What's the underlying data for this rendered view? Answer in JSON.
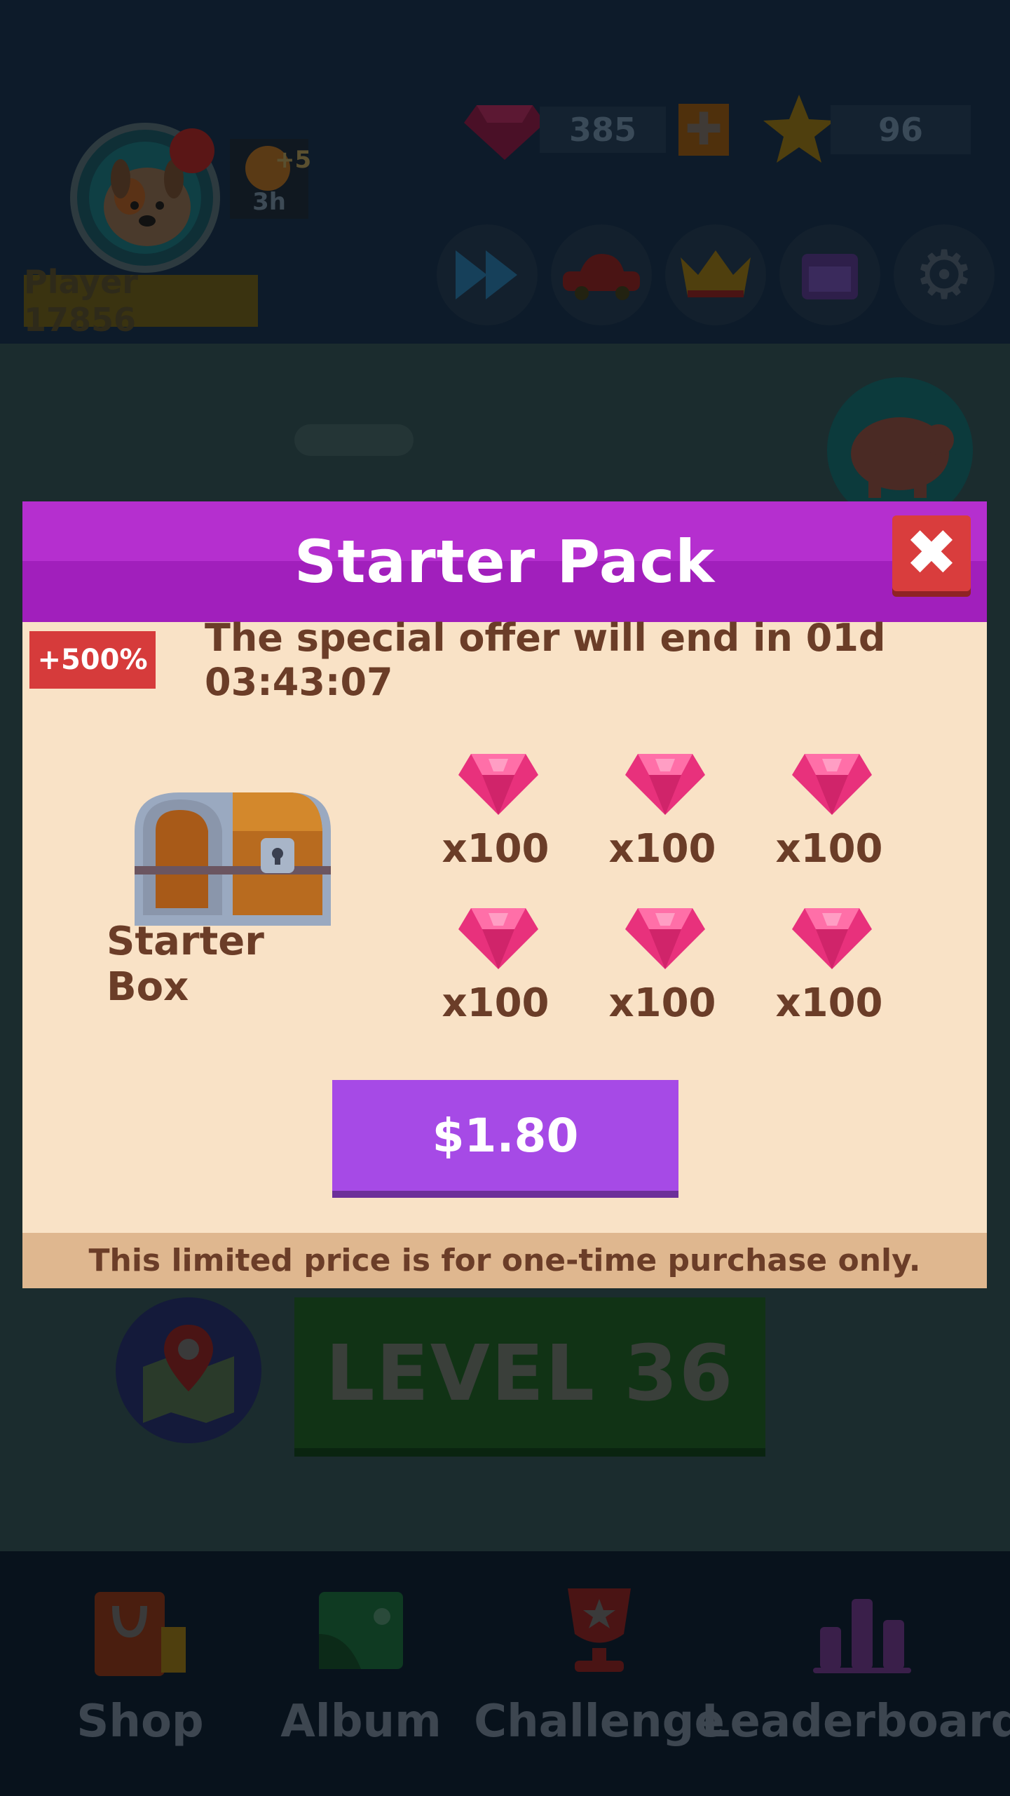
{
  "header": {
    "player_name": "Player 17856",
    "energy_bonus": "+5",
    "energy_timer": "3h",
    "gems": "385",
    "stars": "96"
  },
  "level": {
    "label": "LEVEL 36"
  },
  "modal": {
    "title": "Starter Pack",
    "badge": "+500%",
    "offer_text": "The special offer will end in 01d 03:43:07",
    "box_label": "Starter Box",
    "gem_quantities": [
      "x100",
      "x100",
      "x100",
      "x100",
      "x100",
      "x100"
    ],
    "price": "$1.80",
    "footer": "This limited price is for one-time purchase only."
  },
  "nav": {
    "shop": "Shop",
    "album": "Album",
    "challenge": "Challenge",
    "leaderboard": "Leaderboard"
  },
  "colors": {
    "header_purple": "#a11fbc",
    "panel_bg": "#f9e2c6",
    "buy_button": "#a64ae6",
    "gem_pink": "#e8317c",
    "close_red": "#d93d3d"
  }
}
